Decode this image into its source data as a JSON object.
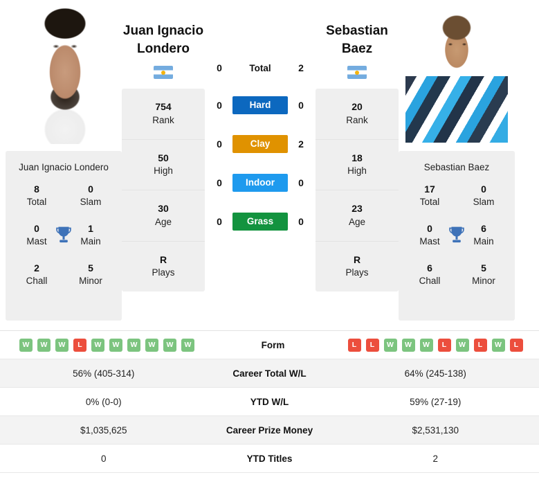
{
  "players": {
    "left": {
      "name_line1": "Juan Ignacio",
      "name_line2": "Londero",
      "full_name": "Juan Ignacio Londero",
      "country": "Argentina",
      "flag_icon": "flag-argentina",
      "photo_alt": "juan-ignacio-londero-portrait",
      "info": [
        {
          "value": "754",
          "label": "Rank"
        },
        {
          "value": "50",
          "label": "High"
        },
        {
          "value": "30",
          "label": "Age"
        },
        {
          "value": "R",
          "label": "Plays"
        }
      ],
      "titles": {
        "total_value": "8",
        "total_label": "Total",
        "slam_value": "0",
        "slam_label": "Slam",
        "mast_value": "0",
        "mast_label": "Mast",
        "main_value": "1",
        "main_label": "Main",
        "chall_value": "2",
        "chall_label": "Chall",
        "minor_value": "5",
        "minor_label": "Minor"
      },
      "form": [
        "W",
        "W",
        "W",
        "L",
        "W",
        "W",
        "W",
        "W",
        "W",
        "W"
      ],
      "career_total_wl": "56% (405-314)",
      "ytd_wl": "0% (0-0)",
      "career_prize_money": "$1,035,625",
      "ytd_titles": "0"
    },
    "right": {
      "name_line1": "Sebastian",
      "name_line2": "Baez",
      "full_name": "Sebastian Baez",
      "country": "Argentina",
      "flag_icon": "flag-argentina",
      "photo_alt": "sebastian-baez-portrait",
      "info": [
        {
          "value": "20",
          "label": "Rank"
        },
        {
          "value": "18",
          "label": "High"
        },
        {
          "value": "23",
          "label": "Age"
        },
        {
          "value": "R",
          "label": "Plays"
        }
      ],
      "titles": {
        "total_value": "17",
        "total_label": "Total",
        "slam_value": "0",
        "slam_label": "Slam",
        "mast_value": "0",
        "mast_label": "Mast",
        "main_value": "6",
        "main_label": "Main",
        "chall_value": "6",
        "chall_label": "Chall",
        "minor_value": "5",
        "minor_label": "Minor"
      },
      "form": [
        "L",
        "L",
        "W",
        "W",
        "W",
        "L",
        "W",
        "L",
        "W",
        "L"
      ],
      "career_total_wl": "64% (245-138)",
      "ytd_wl": "59% (27-19)",
      "career_prize_money": "$2,531,130",
      "ytd_titles": "2"
    }
  },
  "head_to_head": [
    {
      "label": "Total",
      "left": "0",
      "right": "2",
      "color": null,
      "pill": false
    },
    {
      "label": "Hard",
      "left": "0",
      "right": "0",
      "color": "#0c68bf",
      "pill": true
    },
    {
      "label": "Clay",
      "left": "0",
      "right": "2",
      "color": "#e09200",
      "pill": true
    },
    {
      "label": "Indoor",
      "left": "0",
      "right": "0",
      "color": "#1e9aee",
      "pill": true
    },
    {
      "label": "Grass",
      "left": "0",
      "right": "0",
      "color": "#13933f",
      "pill": true
    }
  ],
  "stats_rows": [
    {
      "label": "Form",
      "type": "form"
    },
    {
      "label": "Career Total W/L",
      "left": "56% (405-314)",
      "right": "64% (245-138)"
    },
    {
      "label": "YTD W/L",
      "left": "0% (0-0)",
      "right": "59% (27-19)"
    },
    {
      "label": "Career Prize Money",
      "left": "$1,035,625",
      "right": "$2,531,130"
    },
    {
      "label": "YTD Titles",
      "left": "0",
      "right": "2"
    }
  ],
  "colors": {
    "badge_win": "#7cc47f",
    "badge_loss": "#ec4e3d",
    "card_bg": "#efefef",
    "row_alt_bg": "#f3f3f3",
    "trophy": "#3e72b8"
  },
  "icons": {
    "trophy": "trophy-icon",
    "flag": "flag-icon"
  }
}
